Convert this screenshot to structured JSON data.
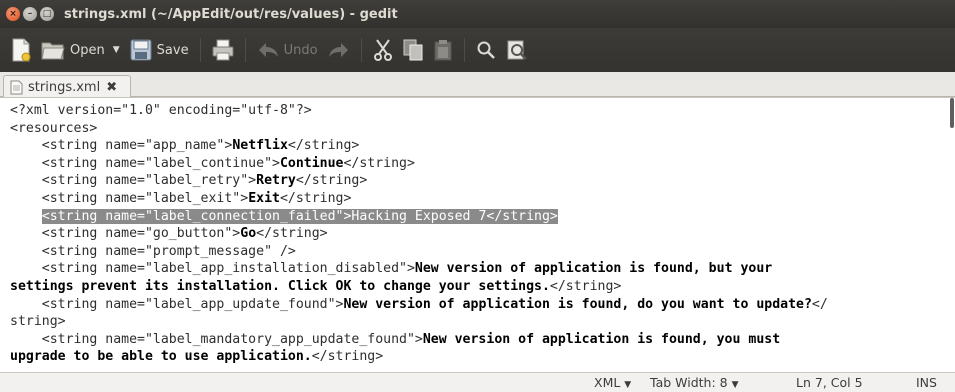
{
  "window": {
    "title": "strings.xml (~/AppEdit/out/res/values) - gedit",
    "controls": {
      "close": "×",
      "minimize": "–",
      "maximize": "□"
    }
  },
  "toolbar": {
    "open_label": "Open",
    "save_label": "Save",
    "undo_label": "Undo"
  },
  "tabs": [
    {
      "label": "strings.xml",
      "close": "✖"
    }
  ],
  "editor": {
    "lines": [
      [
        [
          "",
          "<?xml version=\"1.0\" encoding=\"utf-8\"?>"
        ]
      ],
      [
        [
          "",
          "<resources>"
        ]
      ],
      [
        [
          "",
          "    <string name=\"app_name\">"
        ],
        [
          "b",
          "Netflix"
        ],
        [
          "",
          "</string>"
        ]
      ],
      [
        [
          "",
          "    <string name=\"label_continue\">"
        ],
        [
          "b",
          "Continue"
        ],
        [
          "",
          "</string>"
        ]
      ],
      [
        [
          "",
          "    <string name=\"label_retry\">"
        ],
        [
          "b",
          "Retry"
        ],
        [
          "",
          "</string>"
        ]
      ],
      [
        [
          "",
          "    <string name=\"label_exit\">"
        ],
        [
          "b",
          "Exit"
        ],
        [
          "",
          "</string>"
        ]
      ],
      [
        [
          "",
          "    "
        ],
        [
          "h",
          "<string name=\"label_connection_failed\">Hacking Exposed 7</string>"
        ]
      ],
      [
        [
          "",
          "    <string name=\"go_button\">"
        ],
        [
          "b",
          "Go"
        ],
        [
          "",
          "</string>"
        ]
      ],
      [
        [
          "",
          "    <string name=\"prompt_message\" />"
        ]
      ],
      [
        [
          "",
          "    <string name=\"label_app_installation_disabled\">"
        ],
        [
          "b",
          "New version of application is found, but your"
        ]
      ],
      [
        [
          "b",
          "settings prevent its installation. Click OK to change your settings."
        ],
        [
          "",
          "</string>"
        ]
      ],
      [
        [
          "",
          "    <string name=\"label_app_update_found\">"
        ],
        [
          "b",
          "New version of application is found, do you want to update?"
        ],
        [
          "",
          "</"
        ]
      ],
      [
        [
          "",
          "string>"
        ]
      ],
      [
        [
          "",
          "    <string name=\"label_mandatory_app_update_found\">"
        ],
        [
          "b",
          "New version of application is found, you must"
        ]
      ],
      [
        [
          "b",
          "upgrade to be able to use application."
        ],
        [
          "",
          "</string>"
        ]
      ]
    ]
  },
  "statusbar": {
    "language": "XML",
    "tab_width": "Tab Width: 8",
    "position": "Ln 7, Col 5",
    "mode": "INS"
  }
}
